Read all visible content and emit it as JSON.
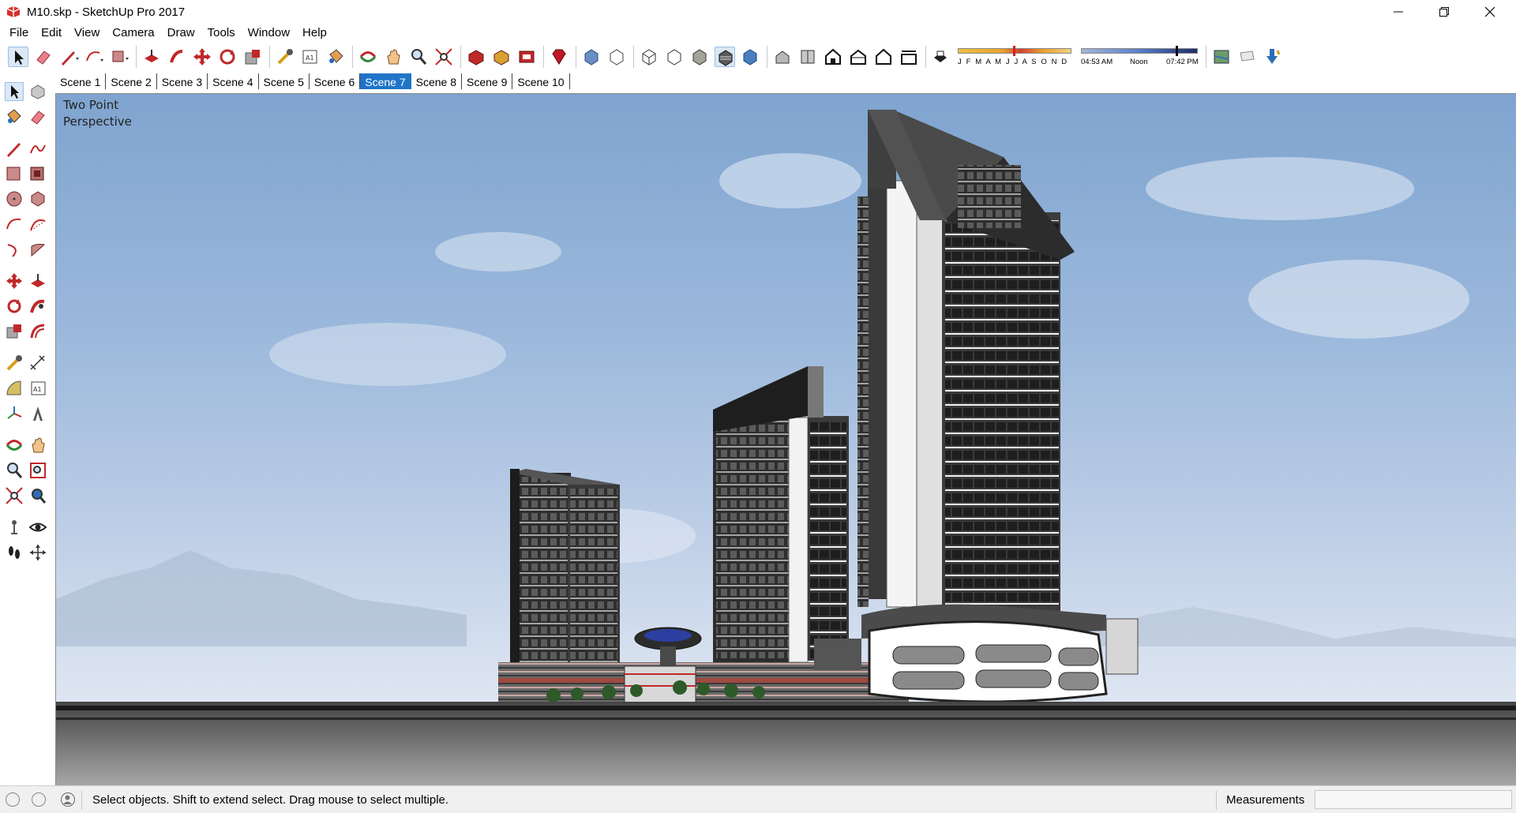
{
  "window": {
    "title": "M10.skp - SketchUp Pro 2017",
    "controls": {
      "minimize": "minimize-icon",
      "maximize": "restore-icon",
      "close": "close-icon"
    }
  },
  "menu": [
    "File",
    "Edit",
    "View",
    "Camera",
    "Draw",
    "Tools",
    "Window",
    "Help"
  ],
  "toolbar": {
    "shadow_months": "J F M A M J J A S O N D",
    "time_start": "04:53 AM",
    "time_noon": "Noon",
    "time_end": "07:42 PM"
  },
  "scenes": {
    "tabs": [
      "Scene 1",
      "Scene 2",
      "Scene 3",
      "Scene 4",
      "Scene 5",
      "Scene 6",
      "Scene 7",
      "Scene 8",
      "Scene 9",
      "Scene 10"
    ],
    "active_index": 6
  },
  "viewport": {
    "camera_label_line1": "Two Point",
    "camera_label_line2": "Perspective"
  },
  "status": {
    "hint": "Select objects. Shift to extend select. Drag mouse to select multiple.",
    "measurements_label": "Measurements",
    "measurements_value": ""
  },
  "colors": {
    "accent": "#1f74c8",
    "sky_top": "#7fa4cf",
    "sky_bottom": "#e9eef5",
    "tool_red": "#c0282a",
    "tool_blue": "#2d6db5"
  }
}
